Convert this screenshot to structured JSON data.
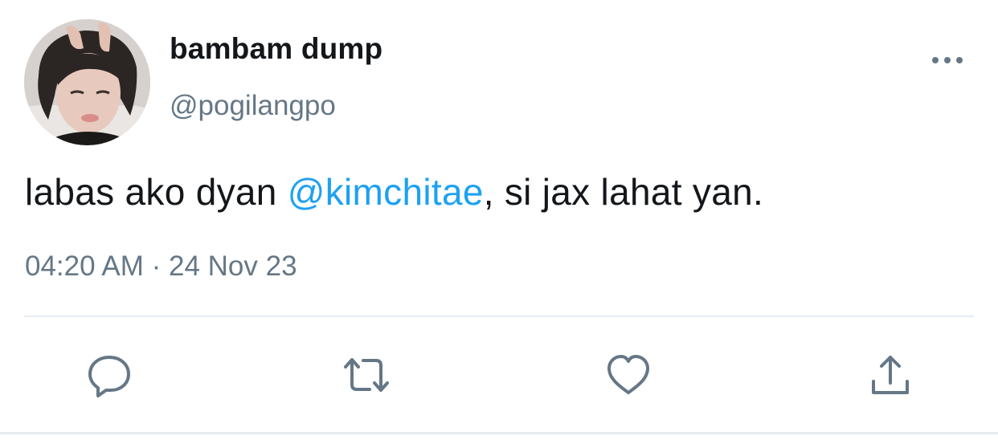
{
  "tweet": {
    "display_name": "bambam dump",
    "handle": "@pogilangpo",
    "text_before": "labas ako dyan ",
    "mention": "@kimchitae",
    "text_after": ", si jax lahat yan.",
    "time": "04:20 AM",
    "separator": " · ",
    "date": "24 Nov 23"
  },
  "icons": {
    "more": "more-horizontal-icon",
    "reply": "reply-bubble-icon",
    "retweet": "retweet-icon",
    "like": "heart-icon",
    "share": "share-upload-icon"
  },
  "colors": {
    "text": "#14171a",
    "secondary": "#657786",
    "accent": "#1da1f2",
    "divider": "#e6ecf0"
  }
}
